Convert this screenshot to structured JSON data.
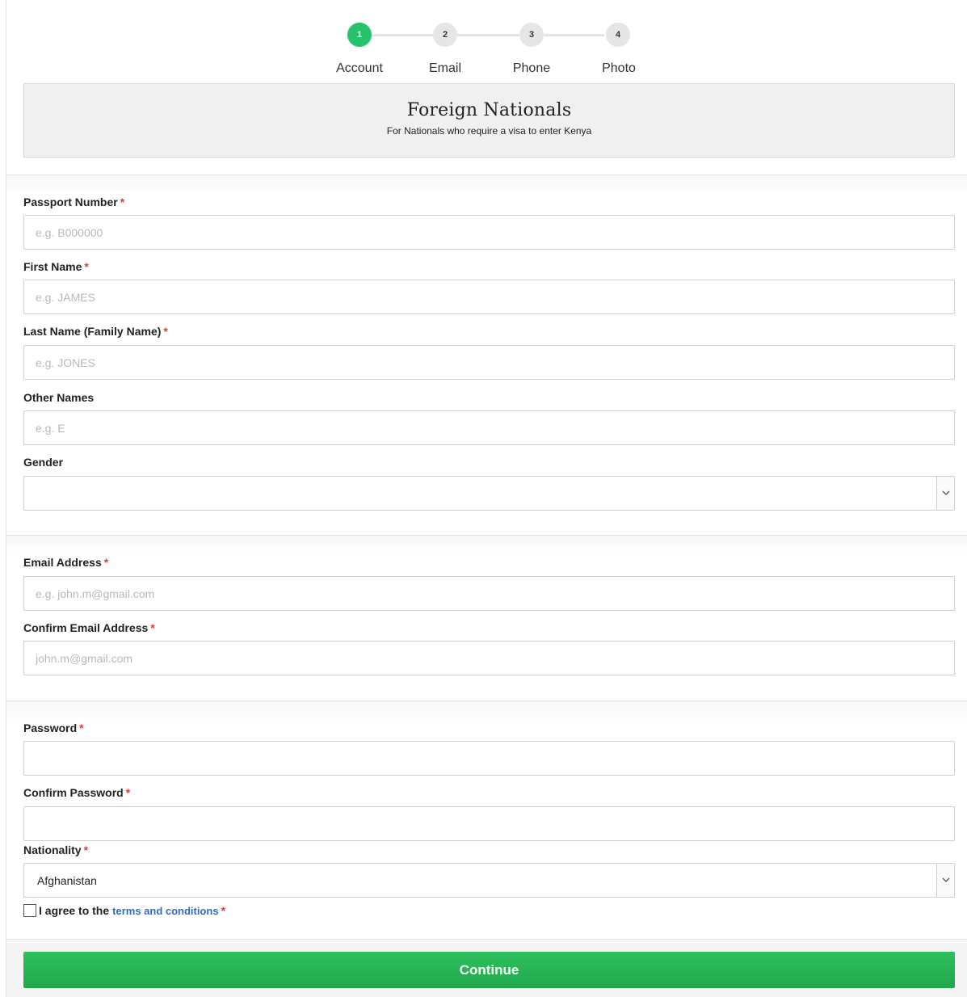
{
  "stepper": {
    "steps": [
      {
        "number": "1",
        "label": "Account",
        "active": true
      },
      {
        "number": "2",
        "label": "Email",
        "active": false
      },
      {
        "number": "3",
        "label": "Phone",
        "active": false
      },
      {
        "number": "4",
        "label": "Photo",
        "active": false
      }
    ]
  },
  "banner": {
    "title": "Foreign Nationals",
    "subtitle": "For Nationals who require a visa to enter Kenya"
  },
  "form": {
    "required_mark": "*",
    "passport": {
      "label": "Passport Number",
      "placeholder": "e.g. B000000"
    },
    "first_name": {
      "label": "First Name",
      "placeholder": "e.g. JAMES"
    },
    "last_name": {
      "label": "Last Name (Family Name)",
      "placeholder": "e.g. JONES"
    },
    "other_names": {
      "label": "Other Names",
      "placeholder": "e.g. E"
    },
    "gender": {
      "label": "Gender",
      "value": ""
    },
    "email": {
      "label": "Email Address",
      "placeholder": "e.g. john.m@gmail.com"
    },
    "confirm_email": {
      "label": "Confirm Email Address",
      "placeholder": "john.m@gmail.com"
    },
    "password": {
      "label": "Password",
      "value": ""
    },
    "confirm_password": {
      "label": "Confirm Password",
      "value": ""
    },
    "nationality": {
      "label": "Nationality",
      "value": "Afghanistan"
    },
    "agree": {
      "text": "I agree to the",
      "link": "terms and conditions"
    },
    "continue_label": "Continue"
  },
  "colors": {
    "accent_green": "#27c36a",
    "required_red": "#e03a3a",
    "link_blue": "#2f6dc5"
  }
}
